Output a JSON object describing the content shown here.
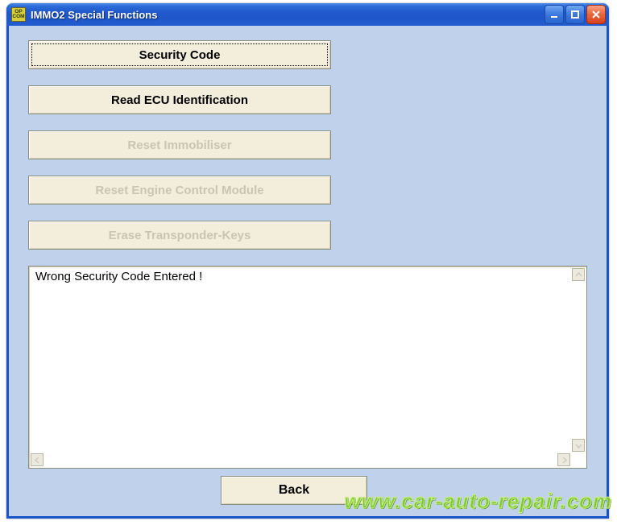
{
  "window": {
    "title": "IMMO2 Special Functions",
    "app_icon_text": "OP\nCOM"
  },
  "buttons": {
    "security": {
      "label": "Security Code",
      "enabled": true,
      "focused": true
    },
    "readecu": {
      "label": "Read ECU Identification",
      "enabled": true,
      "focused": false
    },
    "resetimmo": {
      "label": "Reset Immobiliser",
      "enabled": false,
      "focused": false
    },
    "resetecm": {
      "label": "Reset Engine Control Module",
      "enabled": false,
      "focused": false
    },
    "erasekeys": {
      "label": "Erase Transponder-Keys",
      "enabled": false,
      "focused": false
    },
    "back": {
      "label": "Back"
    }
  },
  "message_panel": {
    "text": "Wrong Security Code Entered !"
  },
  "watermark": "www.car-auto-repair.com"
}
